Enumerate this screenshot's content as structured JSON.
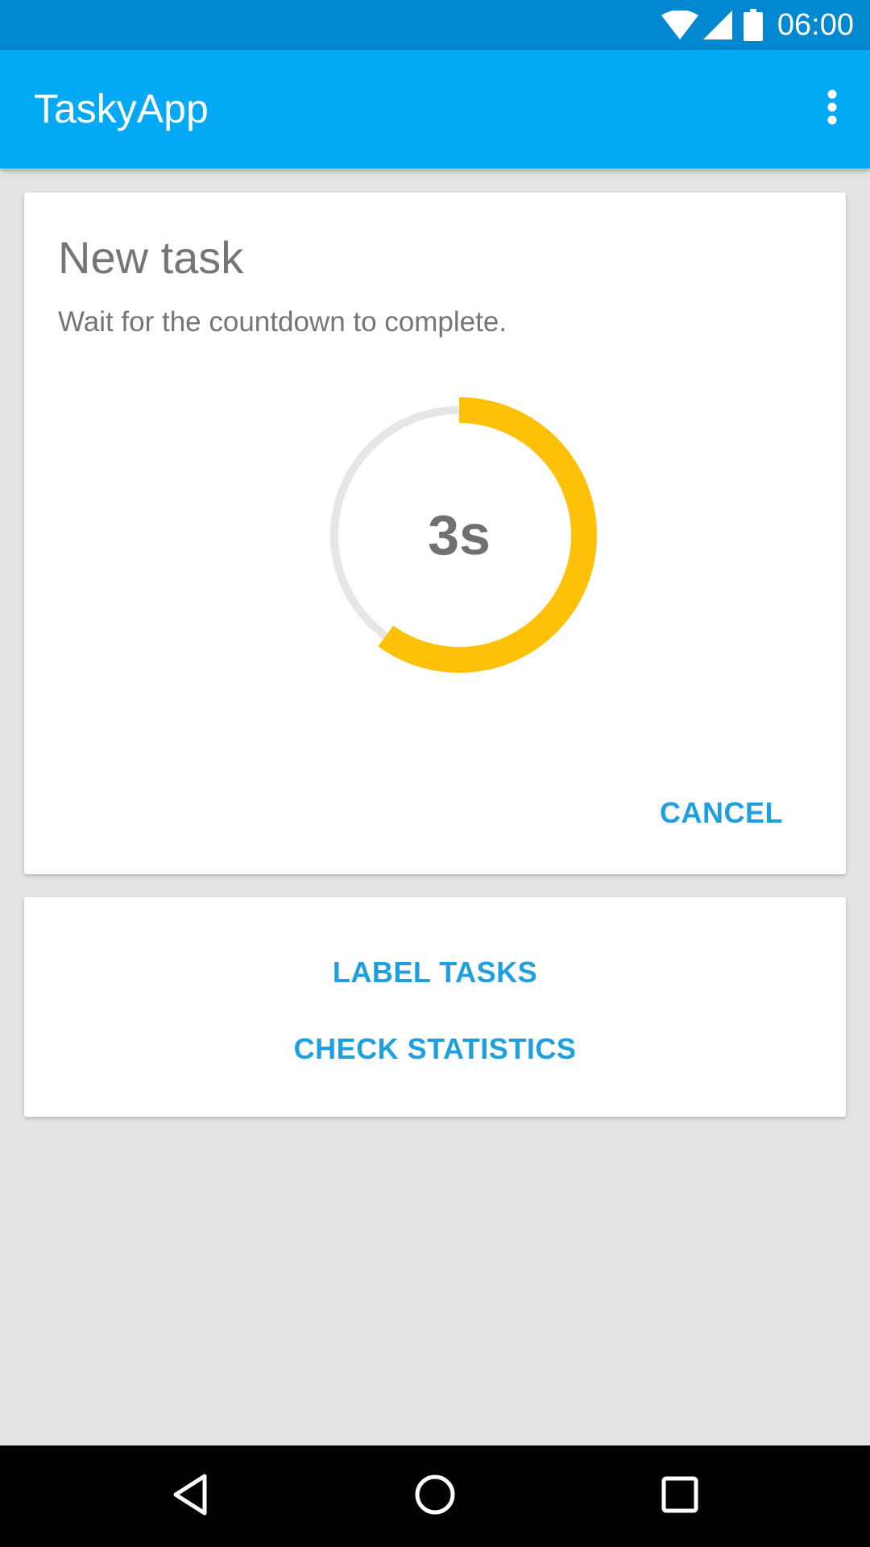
{
  "status_bar": {
    "time": "06:00",
    "icons": [
      "wifi-icon",
      "cellular-signal-icon",
      "battery-icon"
    ]
  },
  "app_bar": {
    "title": "TaskyApp",
    "overflow_icon": "more-vert-icon"
  },
  "task_card": {
    "title": "New task",
    "description": "Wait for the countdown to complete.",
    "countdown": {
      "label": "3s",
      "progress_fraction": 0.6,
      "progress_color": "#ffc107",
      "track_color": "#e6e6e6"
    },
    "cancel_label": "CANCEL"
  },
  "menu_card": {
    "label_tasks": "LABEL TASKS",
    "check_statistics": "CHECK STATISTICS"
  },
  "nav_bar": {
    "icons": [
      "back-icon",
      "home-icon",
      "recents-icon"
    ]
  },
  "colors": {
    "status_bar": "#0288d1",
    "app_bar": "#03a9f4",
    "accent": "#1ea0e0",
    "background": "#e3e3e3"
  }
}
